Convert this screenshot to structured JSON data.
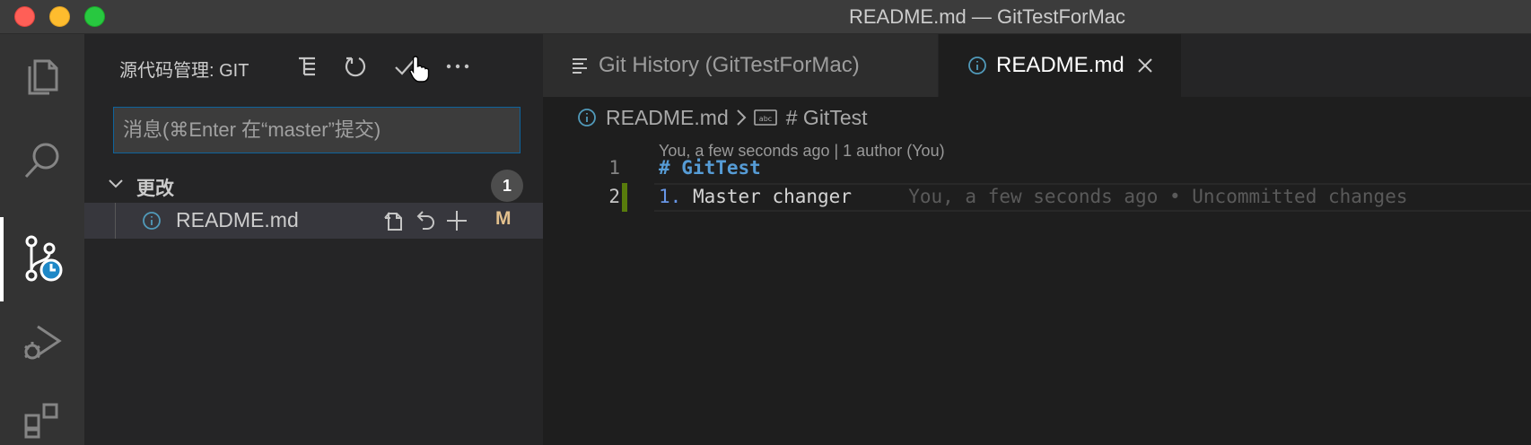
{
  "window": {
    "title": "README.md — GitTestForMac"
  },
  "activity_bar": {
    "items": [
      {
        "icon": "files-icon"
      },
      {
        "icon": "search-icon"
      },
      {
        "icon": "source-control-icon",
        "active": true
      },
      {
        "icon": "run-debug-icon"
      },
      {
        "icon": "extensions-icon"
      }
    ]
  },
  "sidebar": {
    "title": "源代码管理: GIT",
    "toolbar": [
      "tree-view-icon",
      "refresh-icon",
      "commit-check-icon",
      "more-actions-icon"
    ],
    "commit_placeholder": "消息(⌘Enter 在“master”提交)",
    "changes_group": {
      "label": "更改",
      "count": "1",
      "files": [
        {
          "name": "README.md",
          "status": "M",
          "actions": [
            "open-file-icon",
            "discard-icon",
            "stage-icon"
          ]
        }
      ]
    }
  },
  "tabs": [
    {
      "label": "Git History (GitTestForMac)",
      "active": false,
      "icon": "history-list-icon"
    },
    {
      "label": "README.md",
      "active": true,
      "icon": "info-icon"
    }
  ],
  "breadcrumb": {
    "file": "README.md",
    "symbol": "# GitTest"
  },
  "editor": {
    "codelens": "You, a few seconds ago | 1 author (You)",
    "lines": [
      {
        "number": "1",
        "text": "# GitTest"
      },
      {
        "number": "2",
        "list_marker": "1.",
        "text": "Master changer",
        "blame": "You, a few seconds ago • Uncommitted changes"
      }
    ]
  },
  "colors": {
    "accent": "#0e639c",
    "modified": "#e2c08d",
    "gutter_modified": "#587c0c",
    "md_heading": "#569cd6"
  }
}
